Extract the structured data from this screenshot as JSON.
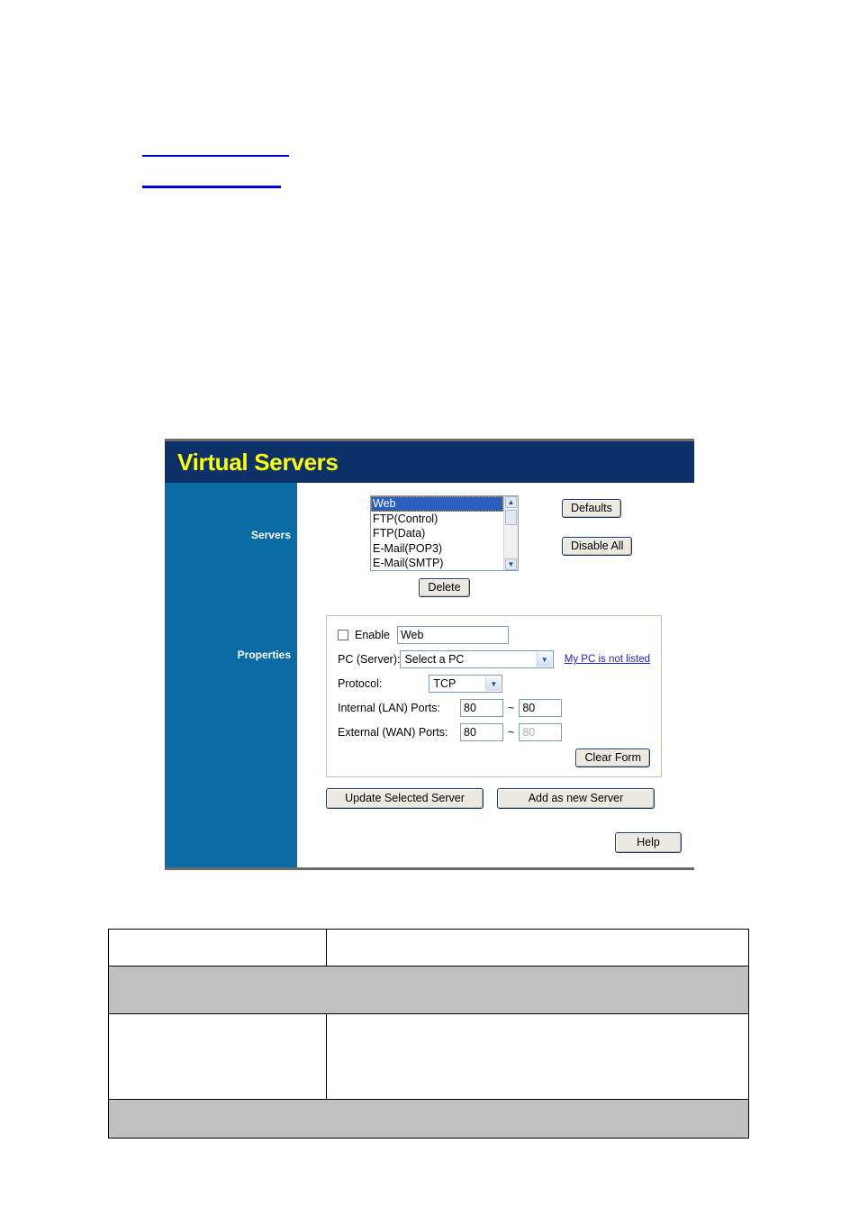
{
  "top_links": [
    {
      "label": ""
    },
    {
      "label": ""
    }
  ],
  "panel": {
    "title": "Virtual Servers",
    "sidebar": {
      "servers_label": "Servers",
      "properties_label": "Properties"
    },
    "servers": {
      "list_items": [
        {
          "label": "Web",
          "selected": true
        },
        {
          "label": "FTP(Control)",
          "selected": false
        },
        {
          "label": "FTP(Data)",
          "selected": false
        },
        {
          "label": "E-Mail(POP3)",
          "selected": false
        },
        {
          "label": "E-Mail(SMTP)",
          "selected": false
        }
      ],
      "defaults_button": "Defaults",
      "disable_all_button": "Disable All",
      "delete_button": "Delete"
    },
    "properties": {
      "enable_label": "Enable",
      "enable_checked": false,
      "name_value": "Web",
      "pc_server_label": "PC (Server):",
      "pc_server_value": "Select a PC",
      "pc_not_listed_link": "My PC is not listed",
      "protocol_label": "Protocol:",
      "protocol_value": "TCP",
      "internal_ports_label": "Internal (LAN) Ports:",
      "internal_port_start": "80",
      "internal_port_end": "80",
      "external_ports_label": "External (WAN) Ports:",
      "external_port_start": "80",
      "external_port_end": "80",
      "range_separator": "~",
      "clear_form_button": "Clear Form"
    },
    "actions": {
      "update_button": "Update Selected Server",
      "add_button": "Add as new Server",
      "help_button": "Help"
    }
  },
  "bottom_table": {
    "rows": [
      {
        "c1": "",
        "c2": ""
      },
      {
        "c1": "",
        "c2": ""
      },
      {
        "c1": "",
        "c2": ""
      },
      {
        "c1": "",
        "c2": ""
      }
    ]
  },
  "colors": {
    "title_bar": "#0b3168",
    "sidebar": "#0a6ba5",
    "title_text": "#ffff00",
    "link": "#2222cc",
    "selection": "#2a5fc0",
    "table_shade": "#c0c0c0"
  }
}
